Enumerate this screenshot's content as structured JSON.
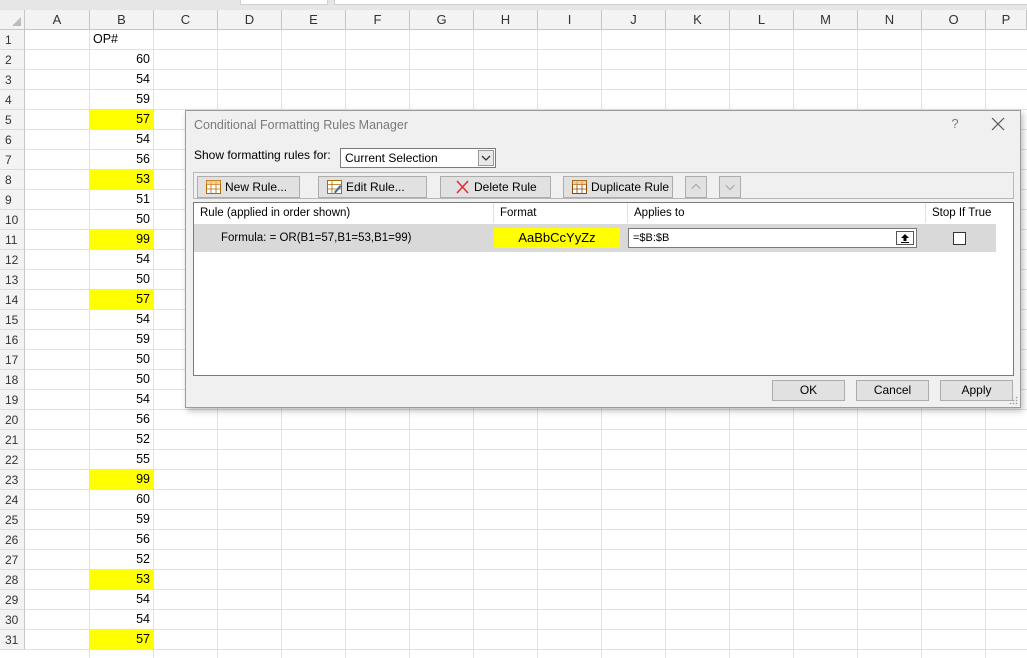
{
  "sheet": {
    "columns": [
      "A",
      "B",
      "C",
      "D",
      "E",
      "F",
      "G",
      "H",
      "I",
      "J",
      "K",
      "L",
      "M",
      "N",
      "O",
      "P"
    ],
    "rows": [
      "1",
      "2",
      "3",
      "4",
      "5",
      "6",
      "7",
      "8",
      "9",
      "10",
      "11",
      "12",
      "13",
      "14",
      "15",
      "16",
      "17",
      "18",
      "19",
      "20",
      "21",
      "22",
      "23",
      "24",
      "25",
      "26",
      "27",
      "28",
      "29",
      "30",
      "31"
    ],
    "b_header": "OP#",
    "b_values": [
      "60",
      "54",
      "59",
      "57",
      "54",
      "56",
      "53",
      "51",
      "50",
      "99",
      "54",
      "50",
      "57",
      "54",
      "59",
      "50",
      "50",
      "54",
      "56",
      "52",
      "55",
      "99",
      "60",
      "59",
      "56",
      "52",
      "53",
      "54",
      "54",
      "57"
    ],
    "highlight_color": "#ffff00"
  },
  "dialog": {
    "title": "Conditional Formatting Rules Manager",
    "help": "?",
    "close": "✕",
    "show_label": "Show formatting rules for:",
    "show_value": "Current Selection",
    "new_rule": "New Rule...",
    "edit_rule": "Edit Rule...",
    "delete_rule": "Delete Rule",
    "duplicate_rule": "Duplicate Rule",
    "columns": {
      "rule": "Rule (applied in order shown)",
      "format": "Format",
      "applies": "Applies to",
      "stop": "Stop If True"
    },
    "rule_row": {
      "rule": "Formula: = OR(B1=57,B1=53,B1=99)",
      "format_preview": "AaBbCcYyZz",
      "applies_to": "=$B:$B",
      "stop_if_true": false
    },
    "ok": "OK",
    "cancel": "Cancel",
    "apply": "Apply"
  }
}
